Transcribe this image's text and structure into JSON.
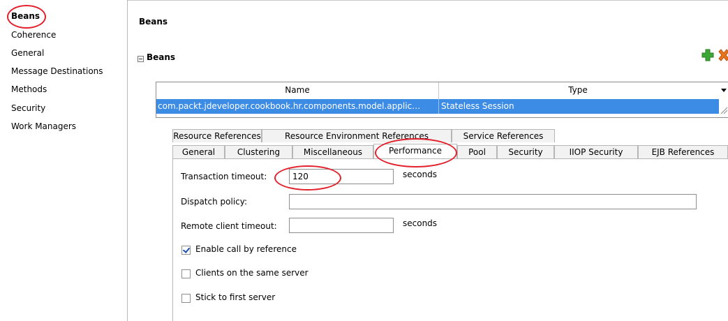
{
  "sidebar": {
    "items": [
      {
        "label": "Beans",
        "selected": true
      },
      {
        "label": "Coherence"
      },
      {
        "label": "General"
      },
      {
        "label": "Message Destinations"
      },
      {
        "label": "Methods"
      },
      {
        "label": "Security"
      },
      {
        "label": "Work Managers"
      }
    ]
  },
  "main": {
    "title": "Beans",
    "section": {
      "title": "Beans",
      "expanded": true
    },
    "toolbar": {
      "add_icon": "add-icon",
      "delete_icon": "delete-icon"
    },
    "table": {
      "columns": [
        "Name",
        "Type"
      ],
      "rows": [
        {
          "name": "com.packt.jdeveloper.cookbook.hr.components.model.applic…",
          "type": "Stateless Session",
          "selected": true
        }
      ]
    },
    "tabs": {
      "row1": [
        "Resource References",
        "Resource Environment References",
        "Service References"
      ],
      "row2": [
        "General",
        "Clustering",
        "Miscellaneous",
        "Performance",
        "Pool",
        "Security",
        "IIOP Security",
        "EJB References"
      ],
      "active": "Performance"
    },
    "form": {
      "transaction_timeout": {
        "label": "Transaction timeout:",
        "value": "120",
        "unit": "seconds"
      },
      "dispatch_policy": {
        "label": "Dispatch policy:",
        "value": ""
      },
      "remote_client_timeout": {
        "label": "Remote client timeout:",
        "value": "",
        "unit": "seconds"
      },
      "checkboxes": [
        {
          "label": "Enable call by reference",
          "checked": true
        },
        {
          "label": "Clients on the same server",
          "checked": false
        },
        {
          "label": "Stick to first server",
          "checked": false
        }
      ]
    }
  },
  "colors": {
    "selection": "#3c8ce6",
    "annotation": "#e3202c",
    "add": "#3aa832",
    "delete": "#e8741c"
  }
}
